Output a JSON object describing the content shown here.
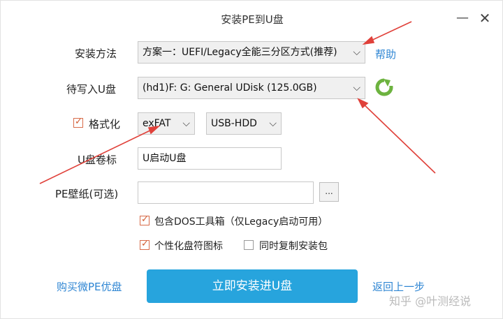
{
  "window": {
    "title": "安装PE到U盘",
    "minimize_glyph": "—",
    "close_glyph": "✕"
  },
  "install_method": {
    "label": "安装方法",
    "selected": "方案一：UEFI/Legacy全能三分区方式(推荐)",
    "help_link": "帮助"
  },
  "target_disk": {
    "label": "待写入U盘",
    "selected": "(hd1)F: G: General UDisk (125.0GB)"
  },
  "format": {
    "label": "格式化",
    "checked": true,
    "filesystem": "exFAT",
    "mode": "USB-HDD"
  },
  "volume_label": {
    "label": "U盘卷标",
    "value": "U启动U盘"
  },
  "wallpaper": {
    "label": "PE壁纸(可选)",
    "value": "",
    "browse_label": "..."
  },
  "options": [
    {
      "label": "包含DOS工具箱（仅Legacy启动可用）",
      "checked": true
    },
    {
      "label": "个性化盘符图标",
      "checked": true
    },
    {
      "label": "同时复制安装包",
      "checked": false
    }
  ],
  "footer": {
    "buy_link": "购买微PE优盘",
    "install_button": "立即安装进U盘",
    "back_link": "返回上一步"
  },
  "watermark": "知乎 @叶测经说",
  "colors": {
    "primary": "#27a4dd",
    "link": "#2f86d3",
    "annotation_arrow": "#e0413a",
    "refresh_icon": "#6db33f"
  }
}
